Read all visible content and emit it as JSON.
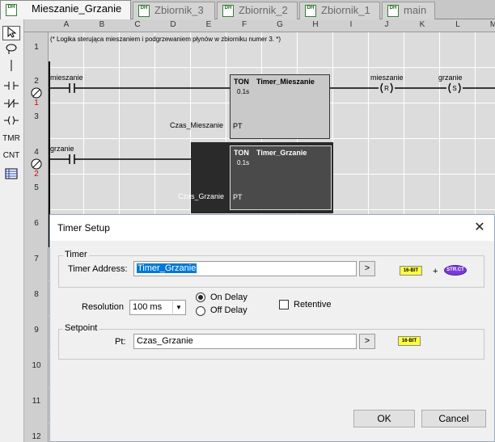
{
  "tabs": [
    {
      "label": "Mieszanie_Grzanie",
      "active": true
    },
    {
      "label": "Zbiornik_3",
      "active": false
    },
    {
      "label": "Zbiornik_2",
      "active": false
    },
    {
      "label": "Zbiornik_1",
      "active": false
    },
    {
      "label": "main",
      "active": false
    }
  ],
  "tab_icon_text": "DH",
  "toolbar": {
    "tools": [
      "select-arrow",
      "lasso",
      "wire",
      "contact-no",
      "contact-nc",
      "coil",
      "TMR",
      "CNT",
      "table"
    ],
    "tmr": "TMR",
    "cnt": "CNT"
  },
  "ladder": {
    "columns": [
      "A",
      "B",
      "C",
      "D",
      "E",
      "F",
      "G",
      "H",
      "I",
      "J",
      "K",
      "L",
      "M"
    ],
    "rows": [
      "1",
      "2",
      "3",
      "4",
      "5",
      "6",
      "7",
      "8",
      "9",
      "10",
      "11",
      "12"
    ],
    "rung_numbers": [
      "1",
      "2"
    ],
    "comment": "(* Logika sterująca mieszaniem i podgrzewaniem płynów w zbiorniku numer 3. *)",
    "rung1": {
      "contact": "mieszanie",
      "timer_type": "TON",
      "timer_name": "Timer_Mieszanie",
      "resolution": "0.1s",
      "pt_input": "Czas_Mieszanie",
      "pt_label": "PT",
      "coil1": "mieszanie",
      "coil1_type": "R",
      "coil2": "grzanie",
      "coil2_type": "S"
    },
    "rung2": {
      "contact": "grzanie",
      "timer_type": "TON",
      "timer_name": "Timer_Grzanie",
      "resolution": "0.1s",
      "pt_input": "Czas_Grzanie",
      "pt_label": "PT"
    }
  },
  "dialog": {
    "title": "Timer Setup",
    "close": "✕",
    "timer_group": "Timer",
    "timer_address_label": "Timer Address:",
    "timer_address_value": "Timer_Grzanie",
    "browse": ">",
    "badge_16bit": "16-BIT",
    "plus": "+",
    "badge_struct": "STR.CT",
    "resolution_label": "Resolution",
    "resolution_value": "100 ms",
    "on_delay": "On Delay",
    "off_delay": "Off Delay",
    "delay_selected": "On Delay",
    "retentive": "Retentive",
    "retentive_checked": false,
    "setpoint_group": "Setpoint",
    "pt_label": "Pt:",
    "pt_value": "Czas_Grzanie",
    "ok": "OK",
    "cancel": "Cancel"
  }
}
